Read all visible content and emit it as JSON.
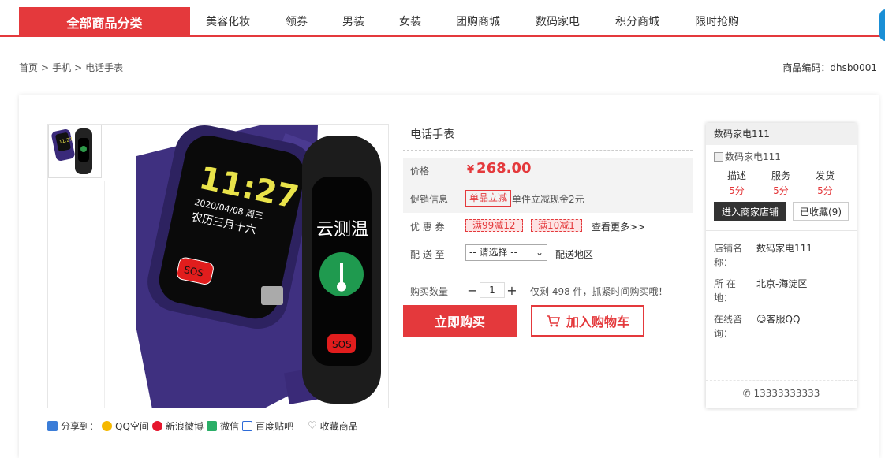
{
  "nav": {
    "all_categories": "全部商品分类",
    "items": [
      "美容化妆",
      "领券",
      "男装",
      "女装",
      "团购商城",
      "数码家电",
      "积分商城",
      "限时抢购"
    ]
  },
  "breadcrumb": {
    "items": [
      "首页",
      "手机",
      "电话手表"
    ],
    "separator": ">"
  },
  "product_code": "商品编码：dhsb0001",
  "product": {
    "title": "电话手表",
    "price_label": "价格",
    "currency": "¥",
    "price": "268.00",
    "promo_label": "促销信息",
    "promo_tag": "单品立减",
    "promo_text": "单件立减现金2元",
    "coupon_label": "优 惠 券",
    "coupons": [
      "满99减12",
      "满10减1"
    ],
    "coupon_more": "查看更多>>",
    "delivery_label": "配 送 至",
    "delivery_select": "-- 请选择 --",
    "delivery_region": "配送地区",
    "qty_label": "购买数量",
    "qty_minus": "−",
    "qty_value": "1",
    "qty_plus": "+",
    "stock_text": "仅剩 498 件，抓紧时间购买哦！",
    "buy_now": "立即购买",
    "add_cart": "加入购物车"
  },
  "image": {
    "watch_time": "11:27",
    "watch_date": "2020/04/08 周三",
    "watch_lunar": "农历三月十六",
    "sos": "SOS",
    "watch2_text": "云测温",
    "sos2": "SOS"
  },
  "share": {
    "label": "分享到：",
    "items": [
      "QQ空间",
      "新浪微博",
      "微信",
      "百度贴吧"
    ],
    "favorite": "收藏商品"
  },
  "shop": {
    "name": "数码家电111",
    "image_alt": "数码家电111",
    "scores": [
      {
        "title": "描述",
        "value": "5分"
      },
      {
        "title": "服务",
        "value": "5分"
      },
      {
        "title": "发货",
        "value": "5分"
      }
    ],
    "enter_store": "进入商家店铺",
    "favorited": "已收藏(9)",
    "store_name_label": "店铺名称：",
    "store_name": "数码家电111",
    "location_label": "所 在 地：",
    "location": "北京-海淀区",
    "consult_label": "在线咨询：",
    "consult": "客服QQ",
    "phone": "13333333333"
  },
  "colors": {
    "accent": "#e4393c",
    "dark_button": "#333333"
  }
}
